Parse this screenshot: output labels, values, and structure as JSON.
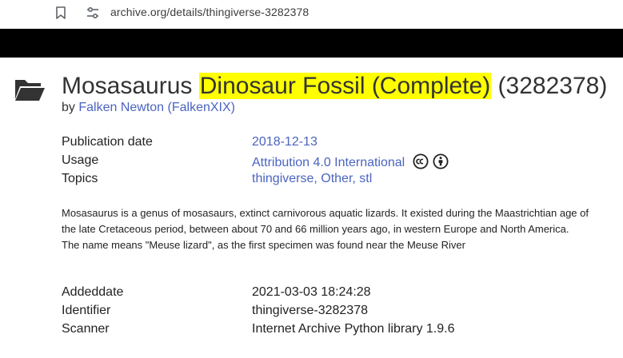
{
  "browser": {
    "url": "archive.org/details/thingiverse-3282378"
  },
  "item": {
    "title_prefix": "Mosasaurus ",
    "title_highlight": "Dinosaur Fossil (Complete)",
    "title_suffix": " (3282378)",
    "by_label": "by",
    "author": "Falken Newton (FalkenXIX)"
  },
  "metadata_top": [
    {
      "key": "Publication date",
      "value": "2018-12-13"
    },
    {
      "key": "Usage",
      "value": "Attribution 4.0 International"
    },
    {
      "key": "Topics",
      "value": "thingiverse, Other, stl"
    }
  ],
  "description": "Mosasaurus is a genus of mosasaurs, extinct carnivorous aquatic lizards. It existed during the Maastrichtian age of the late Cretaceous period, between about 70 and 66 million years ago, in western Europe and North America. The name means \"Meuse lizard\", as the first specimen was found near the Meuse River",
  "metadata_bottom": [
    {
      "key": "Addeddate",
      "value": "2021-03-03 18:24:28"
    },
    {
      "key": "Identifier",
      "value": "thingiverse-3282378"
    },
    {
      "key": "Scanner",
      "value": "Internet Archive Python library 1.9.6"
    }
  ],
  "colors": {
    "link": "#4b64c1",
    "highlight": "#ffff00",
    "header_bar": "#000000"
  },
  "icons": [
    "bookmark-icon",
    "site-info-icon",
    "folder-icon",
    "cc-icon",
    "attribution-icon"
  ]
}
